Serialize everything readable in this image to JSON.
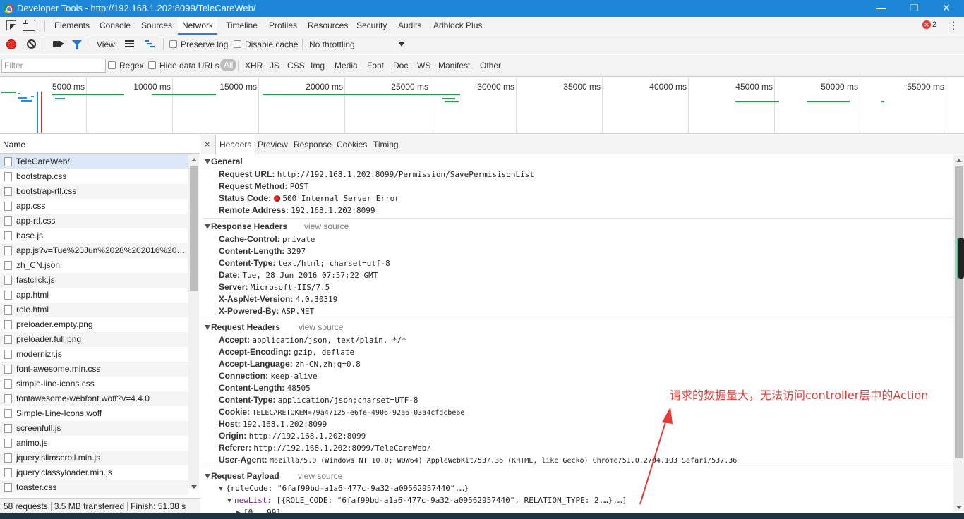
{
  "window": {
    "title": "Developer Tools - http://192.168.1.202:8099/TeleCareWeb/",
    "minimize": "—",
    "restore": "❐",
    "close": "✕"
  },
  "main_tabs": [
    "Elements",
    "Console",
    "Sources",
    "Network",
    "Timeline",
    "Profiles",
    "Resources",
    "Security",
    "Audits",
    "Adblock Plus"
  ],
  "active_main_tab": "Network",
  "error_count": "2",
  "toolbar": {
    "view_label": "View:",
    "preserve_log": "Preserve log",
    "disable_cache": "Disable cache",
    "throttling": "No throttling"
  },
  "filter": {
    "placeholder": "Filter",
    "regex": "Regex",
    "hide_data_urls": "Hide data URLs",
    "types": [
      "All",
      "XHR",
      "JS",
      "CSS",
      "Img",
      "Media",
      "Font",
      "Doc",
      "WS",
      "Manifest",
      "Other"
    ],
    "active_type": "All"
  },
  "overview": {
    "ticks": [
      "5000 ms",
      "10000 ms",
      "15000 ms",
      "20000 ms",
      "25000 ms",
      "30000 ms",
      "35000 ms",
      "40000 ms",
      "45000 ms",
      "50000 ms",
      "55000 ms"
    ]
  },
  "request_list": {
    "column_name": "Name",
    "items": [
      "TeleCareWeb/",
      "bootstrap.css",
      "bootstrap-rtl.css",
      "app.css",
      "app-rtl.css",
      "base.js",
      "app.js?v=Tue%20Jun%2028%202016%2015:...",
      "zh_CN.json",
      "fastclick.js",
      "app.html",
      "role.html",
      "preloader.empty.png",
      "preloader.full.png",
      "modernizr.js",
      "font-awesome.min.css",
      "simple-line-icons.css",
      "fontawesome-webfont.woff?v=4.4.0",
      "Simple-Line-Icons.woff",
      "screenfull.js",
      "animo.js",
      "jquery.slimscroll.min.js",
      "jquery.classyloader.min.js",
      "toaster.css"
    ],
    "status": {
      "requests": "58 requests",
      "transferred": "3.5 MB transferred",
      "finish": "Finish: 51.38 s"
    }
  },
  "detail": {
    "close": "×",
    "tabs": [
      "Headers",
      "Preview",
      "Response",
      "Cookies",
      "Timing"
    ],
    "active_tab": "Headers",
    "view_source": "view source",
    "general": {
      "title": "General",
      "rows": [
        {
          "k": "Request URL:",
          "v": "http://192.168.1.202:8099/Permission/SavePermisisonList"
        },
        {
          "k": "Request Method:",
          "v": "POST"
        },
        {
          "k": "Status Code:",
          "v": "500 Internal Server Error"
        },
        {
          "k": "Remote Address:",
          "v": "192.168.1.202:8099"
        }
      ]
    },
    "response_headers": {
      "title": "Response Headers",
      "rows": [
        {
          "k": "Cache-Control:",
          "v": "private"
        },
        {
          "k": "Content-Length:",
          "v": "3297"
        },
        {
          "k": "Content-Type:",
          "v": "text/html; charset=utf-8"
        },
        {
          "k": "Date:",
          "v": "Tue, 28 Jun 2016 07:57:22 GMT"
        },
        {
          "k": "Server:",
          "v": "Microsoft-IIS/7.5"
        },
        {
          "k": "X-AspNet-Version:",
          "v": "4.0.30319"
        },
        {
          "k": "X-Powered-By:",
          "v": "ASP.NET"
        }
      ]
    },
    "request_headers": {
      "title": "Request Headers",
      "rows": [
        {
          "k": "Accept:",
          "v": "application/json, text/plain, */*"
        },
        {
          "k": "Accept-Encoding:",
          "v": "gzip, deflate"
        },
        {
          "k": "Accept-Language:",
          "v": "zh-CN,zh;q=0.8"
        },
        {
          "k": "Connection:",
          "v": "keep-alive"
        },
        {
          "k": "Content-Length:",
          "v": "48505"
        },
        {
          "k": "Content-Type:",
          "v": "application/json;charset=UTF-8"
        },
        {
          "k": "Cookie:",
          "v": "TELECARETOKEN=79a47125-e6fe-4906-92a6-03a4cfdcbe6e"
        },
        {
          "k": "Host:",
          "v": "192.168.1.202:8099"
        },
        {
          "k": "Origin:",
          "v": "http://192.168.1.202:8099"
        },
        {
          "k": "Referer:",
          "v": "http://192.168.1.202:8099/TeleCareWeb/"
        },
        {
          "k": "User-Agent:",
          "v": "Mozilla/5.0 (Windows NT 10.0; WOW64) AppleWebKit/537.36 (KHTML, like Gecko) Chrome/51.0.2704.103 Safari/537.36"
        }
      ]
    },
    "payload": {
      "title": "Request Payload",
      "line1": "{roleCode: \"6faf99bd-a1a6-477c-9a32-a09562957440\",…}",
      "line2_key": "newList:",
      "line2_val": " [{ROLE_CODE: \"6faf99bd-a1a6-477c-9a32-a09562957440\", RELATION_TYPE: 2,…},…]",
      "line3": "[0 … 99]"
    }
  },
  "annotation": "请求的数据量大，无法访问controller层中的Action",
  "colors": {
    "titlebar": "#1e86d6",
    "accent": "#3879d9",
    "error": "#e0302a",
    "annotation": "#e53935",
    "waterfall_green": "#1aa34a",
    "waterfall_blue": "#1e90e0"
  },
  "icons": [
    "chrome-logo-icon",
    "inspect-icon",
    "device-mode-icon",
    "record-icon",
    "clear-icon",
    "camera-icon",
    "filter-funnel-icon",
    "list-view-icon",
    "waterfall-view-icon",
    "file-icon",
    "close-icon"
  ]
}
